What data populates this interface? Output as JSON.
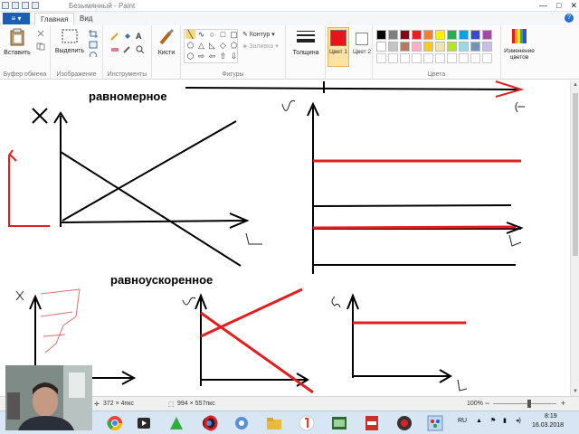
{
  "window": {
    "title": "Безымянный - Paint",
    "controls": [
      "—",
      "□",
      "✕"
    ]
  },
  "tabs": {
    "file": "≡ ▾",
    "home": "Главная",
    "view": "Вид"
  },
  "ribbon": {
    "clipboard": {
      "paste": "Вставить",
      "group": "Буфер обмена"
    },
    "image": {
      "select": "Выделить",
      "group": "Изображение"
    },
    "tools": {
      "group": "Инструменты"
    },
    "brushes": {
      "label": "Кисти"
    },
    "shapes": {
      "outline": "Контур",
      "fill": "Заливка",
      "group": "Фигуры"
    },
    "size": {
      "label": "Толщина"
    },
    "color1": {
      "label": "Цвет 1",
      "color": "#e8141c"
    },
    "color2": {
      "label": "Цвет 2",
      "color": "#ffffff"
    },
    "colors": {
      "group": "Цвета",
      "edit": "Изменение цветов"
    },
    "palette_row1": [
      "#000000",
      "#7f7f7f",
      "#880015",
      "#ed1c24",
      "#ff7f27",
      "#fff200",
      "#22b14c",
      "#00a2e8",
      "#3f48cc",
      "#a349a4"
    ],
    "palette_row2": [
      "#ffffff",
      "#c3c3c3",
      "#b97a57",
      "#ffaec9",
      "#ffc90e",
      "#efe4b0",
      "#b5e61d",
      "#99d9ea",
      "#7092be",
      "#c8bfe7"
    ]
  },
  "canvas": {
    "word_uniform": "равномерное",
    "word_accelerated": "равноускоренное"
  },
  "status": {
    "cursor": "372 × 4пкс",
    "size": "994 × 557пкс",
    "zoom": "100%"
  },
  "taskbar": {
    "lang": "RU",
    "time": "8:19",
    "date": "16.03.2018"
  }
}
